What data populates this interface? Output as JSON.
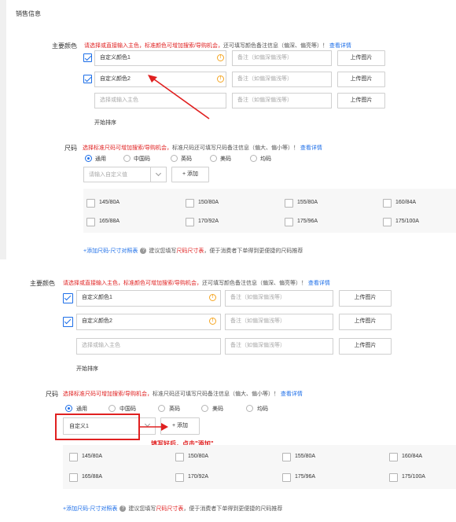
{
  "top": {
    "section_title": "销售信息",
    "color_label": "主要颜色",
    "color_hint_red": "请选择或直接输入主色，标准颜色可增加搜索/导购机会，",
    "color_hint_gray": "还可填写颜色备注信息（偏深、偏亮等）！",
    "color_hint_link": "查看详情",
    "rows": [
      {
        "checked": true,
        "value": "自定义颜色1",
        "note_placeholder": "备注（如偏深偏浅等）",
        "upload": "上传图片"
      },
      {
        "checked": true,
        "value": "自定义颜色2",
        "note_placeholder": "备注（如偏深偏浅等）",
        "upload": "上传图片"
      },
      {
        "checked": false,
        "placeholder": "选择或输入主色",
        "note_placeholder": "备注（如偏深偏浅等）",
        "upload": "上传图片"
      }
    ],
    "sort_label": "开始排序",
    "size_label": "尺码",
    "size_hint_red": "选择标准尺码可增加搜索/导购机会，",
    "size_hint_gray": "标准尺码还可填写尺码备注信息（偏大、偏小等）！",
    "size_hint_link": "查看详情",
    "radios": [
      "通用",
      "中国码",
      "英码",
      "美码",
      "均码"
    ],
    "custom_placeholder": "请输入自定义值",
    "add_button": "+ 添加",
    "sizes": [
      "145/80A",
      "150/80A",
      "155/80A",
      "160/84A",
      "165/88A",
      "170/92A",
      "175/96A",
      "175/100A"
    ],
    "size_table_link": "+添加尺码-尺寸对照表",
    "size_table_hint_gray1": "建议您填写",
    "size_table_hint_red": "尺码尺寸表",
    "size_table_hint_gray2": "，便于消费者下单得到更便捷的尺码推荐"
  },
  "bottom": {
    "color_label": "主要颜色",
    "color_hint_red": "请选择或直接输入主色，标准颜色可增加搜索/导购机会，",
    "color_hint_gray": "还可填写颜色备注信息（偏深、偏亮等）！",
    "color_hint_link": "查看详情",
    "rows": [
      {
        "checked": true,
        "value": "自定义颜色1",
        "note_placeholder": "备注（如偏深偏浅等）",
        "upload": "上传图片"
      },
      {
        "checked": true,
        "value": "自定义颜色2",
        "note_placeholder": "备注（如偏深偏浅等）",
        "upload": "上传图片"
      },
      {
        "checked": false,
        "placeholder": "选择或输入主色",
        "note_placeholder": "备注（如偏深偏浅等）",
        "upload": "上传图片"
      }
    ],
    "sort_label": "开始排序",
    "size_label": "尺码",
    "size_hint_red": "选择标准尺码可增加搜索/导购机会，",
    "size_hint_gray": "标准尺码还可填写尺码备注信息（偏大、偏小等）！",
    "size_hint_link": "查看详情",
    "radios": [
      "通用",
      "中国码",
      "英码",
      "美码",
      "均码"
    ],
    "custom_value": "自定义1",
    "add_button": "+ 添加",
    "annotation": "填写好后，点击\"添加\"",
    "sizes": [
      "145/80A",
      "150/80A",
      "155/80A",
      "160/84A",
      "165/88A",
      "170/92A",
      "175/96A",
      "175/100A"
    ],
    "size_table_link": "+添加尺码-尺寸对照表",
    "size_table_hint_gray1": "建议您填写",
    "size_table_hint_red": "尺码尺寸表",
    "size_table_hint_gray2": "，便于消费者下单得到更便捷的尺码推荐"
  },
  "colors": {
    "accent": "#1c6ee8",
    "warn": "#e02020",
    "orange": "#f5a623"
  }
}
